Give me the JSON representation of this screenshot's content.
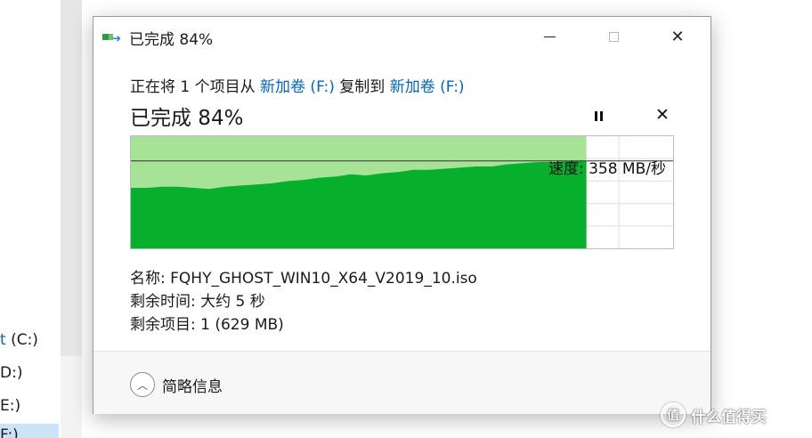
{
  "explorer": {
    "nav_items": [
      {
        "prefix": "t",
        "label": " (C:)"
      },
      {
        "prefix": "",
        "label": "D:)"
      },
      {
        "prefix": "",
        "label": "E:)"
      },
      {
        "prefix": "",
        "label": "F:)"
      }
    ]
  },
  "dialog": {
    "window_title": "已完成 84%",
    "status": {
      "part1": "正在将 1 个项目从 ",
      "source": "新加卷 (F:)",
      "part2": " 复制到 ",
      "destination": "新加卷 (F:)"
    },
    "heading": "已完成 84%",
    "progress_percent": 84,
    "speed_label": "速度: 358 MB/秒",
    "speed_mb_s": 358,
    "name_line": "名称: FQHY_GHOST_WIN10_X64_V2019_10.iso",
    "time_left_line": "剩余时间: 大约 5 秒",
    "items_left_line": "剩余项目: 1 (629 MB)",
    "fewer_details_label": "简略信息",
    "graph_colors": {
      "progress": "#a6e396",
      "speed": "#06b02c",
      "grid": "#d0ead0"
    },
    "speed_history": [
      54,
      54,
      55,
      55,
      54,
      53,
      55,
      56,
      57,
      58,
      60,
      61,
      63,
      64,
      66,
      65,
      67,
      68,
      70,
      70,
      71,
      72,
      73,
      73,
      75,
      76,
      77,
      77,
      78,
      78
    ]
  },
  "watermark": {
    "text": "什么值得买",
    "logo_glyph": "值"
  }
}
